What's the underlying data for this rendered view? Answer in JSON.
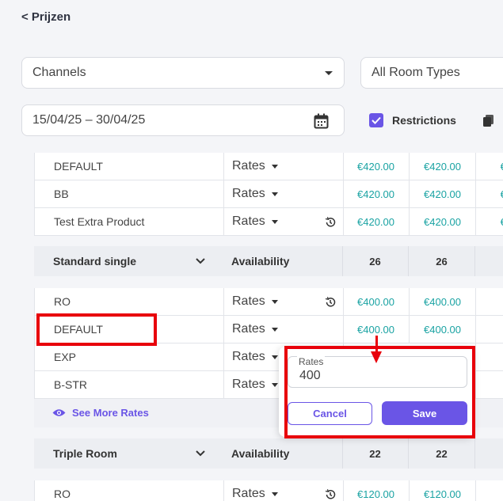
{
  "nav": {
    "back_label": "< Prijzen"
  },
  "filters": {
    "channels_value": "Channels",
    "room_types_value": "All Room Types",
    "date_range": "15/04/25 – 30/04/25",
    "restrictions_label": "Restrictions"
  },
  "rows_top": [
    {
      "name": "DEFAULT",
      "type": "Rates",
      "prices": [
        "€420.00",
        "€420.00",
        "€42"
      ],
      "history": false
    },
    {
      "name": "BB",
      "type": "Rates",
      "prices": [
        "€420.00",
        "€420.00",
        "€42"
      ],
      "history": false
    },
    {
      "name": "Test Extra Product",
      "type": "Rates",
      "prices": [
        "€420.00",
        "€420.00",
        "€42"
      ],
      "history": true
    }
  ],
  "groups": [
    {
      "name": "Standard single",
      "availability_label": "Availability",
      "availability": [
        "26",
        "26"
      ],
      "rows": [
        {
          "name": "RO",
          "type": "Rates",
          "prices": [
            "€400.00",
            "€400.00",
            "€4"
          ],
          "history": true
        },
        {
          "name": "DEFAULT",
          "type": "Rates",
          "prices": [
            "€400.00",
            "€400.00",
            "€4"
          ],
          "history": false
        },
        {
          "name": "EXP",
          "type": "Rates",
          "prices": [
            "",
            "",
            "€4"
          ],
          "history": false
        },
        {
          "name": "B-STR",
          "type": "Rates",
          "prices": [
            "",
            "",
            "€4"
          ],
          "history": false
        }
      ],
      "see_more_label": "See More Rates"
    },
    {
      "name": "Triple Room",
      "availability_label": "Availability",
      "availability": [
        "22",
        "22"
      ],
      "rows": [
        {
          "name": "RO",
          "type": "Rates",
          "prices": [
            "€120.00",
            "€120.00",
            "€1"
          ],
          "history": true
        }
      ]
    }
  ],
  "popup": {
    "field_label": "Rates",
    "field_value": "400",
    "cancel_label": "Cancel",
    "save_label": "Save"
  },
  "colors": {
    "accent": "#6a55e6",
    "price": "#1aa3a3",
    "highlight": "#e8000b"
  },
  "icons": [
    "chevron-down-icon",
    "calendar-icon",
    "check-icon",
    "copy-icon",
    "history-icon",
    "eye-icon",
    "caret-down-icon",
    "arrow-down-icon"
  ]
}
